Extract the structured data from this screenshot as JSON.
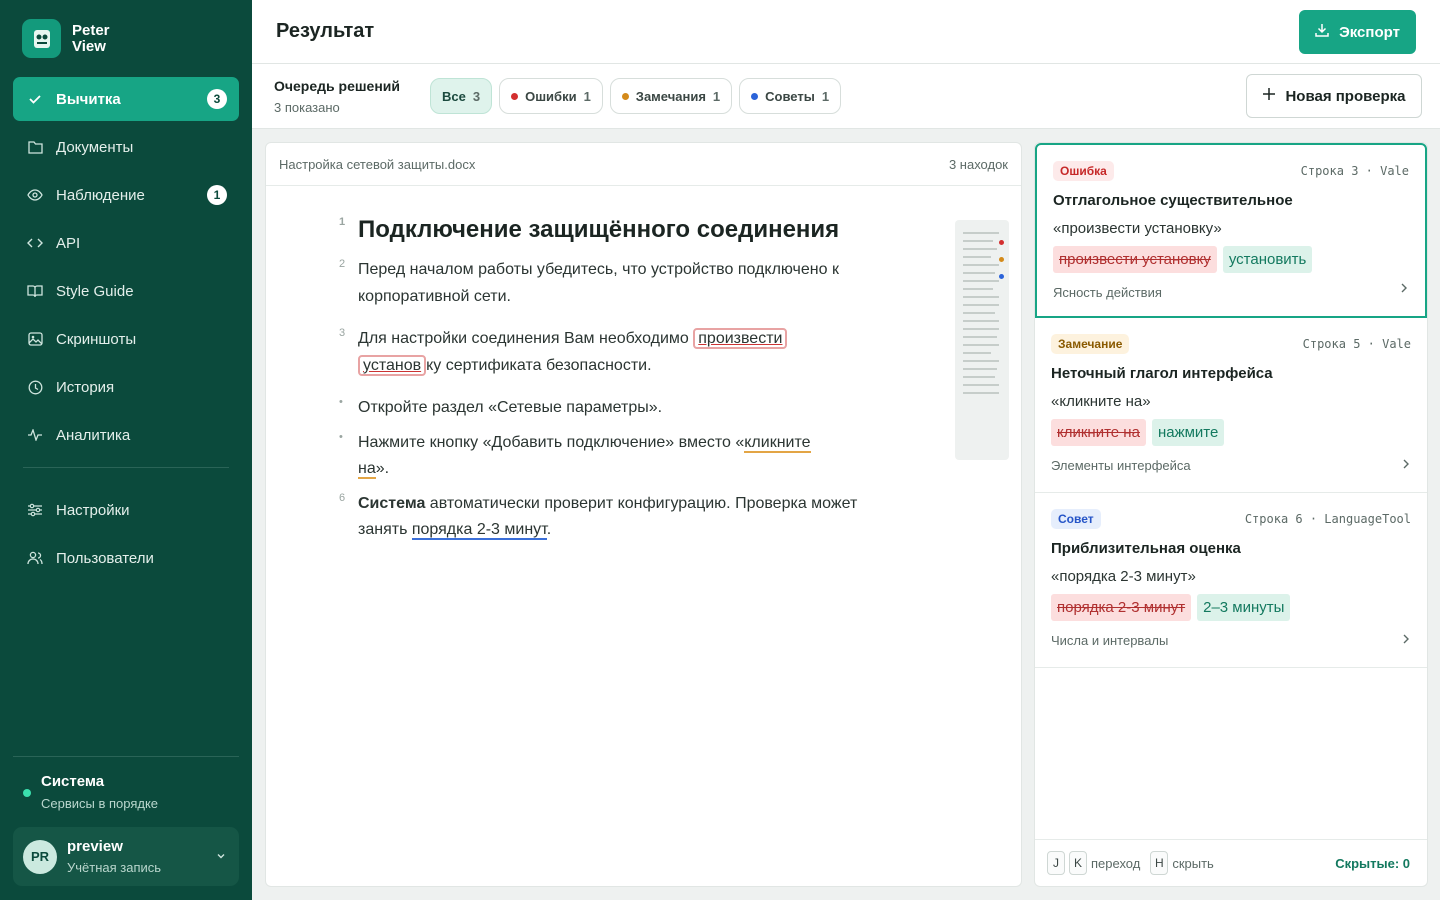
{
  "brand": {
    "name": "Peter View"
  },
  "nav": {
    "items": [
      {
        "label": "Вычитка",
        "badge": "3",
        "icon": "check-icon"
      },
      {
        "label": "Документы",
        "icon": "folder-icon"
      },
      {
        "label": "Наблюдение",
        "badge": "1",
        "icon": "eye-icon"
      },
      {
        "label": "API",
        "icon": "code-icon"
      },
      {
        "label": "Style Guide",
        "icon": "book-icon"
      },
      {
        "label": "Скриншоты",
        "icon": "image-icon"
      },
      {
        "label": "История",
        "icon": "clock-icon"
      },
      {
        "label": "Аналитика",
        "icon": "activity-icon"
      },
      {
        "label": "Настройки",
        "icon": "sliders-icon"
      },
      {
        "label": "Пользователи",
        "icon": "users-icon"
      }
    ]
  },
  "system": {
    "title": "Система",
    "status": "Сервисы в порядке"
  },
  "account": {
    "initials": "PR",
    "name": "preview",
    "sub": "Учётная запись"
  },
  "header": {
    "title": "Результат",
    "export_label": "Экспорт"
  },
  "queue": {
    "title": "Очередь решений",
    "shown": "3 показано",
    "new_check_label": "Новая проверка",
    "filters": [
      {
        "label": "Все",
        "count": "3"
      },
      {
        "label": "Ошибки",
        "count": "1",
        "color": "#d32f2f"
      },
      {
        "label": "Замечания",
        "count": "1",
        "color": "#d48a1a"
      },
      {
        "label": "Советы",
        "count": "1",
        "color": "#2b63d9"
      }
    ]
  },
  "doc": {
    "filename": "Настройка сетевой защиты.docx",
    "findings": "3 находок",
    "lines": {
      "l1": {
        "num": "1",
        "text": "Подключение защищённого соединения"
      },
      "l2": {
        "num": "2",
        "text": "Перед началом работы убедитесь, что устройство подключено к корпоративной сети."
      },
      "l3": {
        "num": "3",
        "pre": "Для настройки соединения Вам необходимо ",
        "hl1": "произвести",
        "hl2": "установ",
        "post": "ку сертификата безопасности."
      },
      "l4": {
        "num": "•",
        "text": "Откройте раздел «Сетевые параметры»."
      },
      "l5": {
        "num": "•",
        "pre": "Нажмите кнопку «Добавить подключение» вместо «",
        "hl1": "кликните",
        "hl2": "на",
        "post": "»."
      },
      "l6": {
        "num": "6",
        "bold": "Система",
        "pre": " автоматически проверит конфигурацию. Проверка может занять ",
        "hl": "порядка 2-3 минут",
        "post": "."
      }
    }
  },
  "issues": {
    "cards": [
      {
        "tag": "Ошибка",
        "meta": "Строка 3 · Vale",
        "title": "Отглагольное существительное",
        "quote": "«произвести установку»",
        "old": "произвести установку",
        "new": "установить",
        "category": "Ясность действия"
      },
      {
        "tag": "Замечание",
        "meta": "Строка 5 · Vale",
        "title": "Неточный глагол интерфейса",
        "quote": "«кликните на»",
        "old": "кликните на",
        "new": "нажмите",
        "category": "Элементы интерфейса"
      },
      {
        "tag": "Совет",
        "meta": "Строка 6 · LanguageTool",
        "title": "Приблизительная оценка",
        "quote": "«порядка 2-3 минут»",
        "old": "порядка 2-3 минут",
        "new": "2–3 минуты",
        "category": "Числа и интервалы"
      }
    ],
    "footer": {
      "key_j": "J",
      "key_k": "K",
      "nav_label": "переход",
      "key_h": "H",
      "hide_label": "скрыть",
      "hidden_count": "Скрытые: 0"
    }
  },
  "colors": {
    "accent": "#17a585",
    "sidebar": "#0b4a3c",
    "error": "#d32f2f",
    "warning": "#d48a1a",
    "tip": "#2b63d9"
  }
}
